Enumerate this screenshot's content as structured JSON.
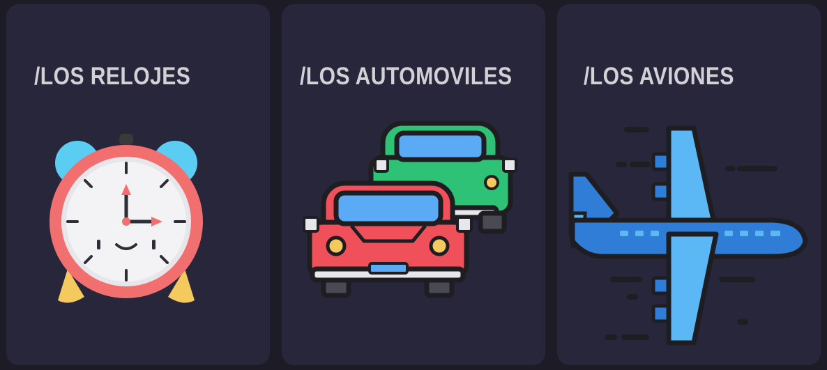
{
  "cards": [
    {
      "title": "/LOS RELOJES",
      "icon": "alarm-clock-icon"
    },
    {
      "title": "/LOS AUTOMOVILES",
      "icon": "cars-icon"
    },
    {
      "title": "/LOS AVIONES",
      "icon": "airplane-icon"
    }
  ],
  "colors": {
    "page_background": "#1c1b26",
    "card_background": "#28263a",
    "title_text": "#d2d2d6",
    "clock_red": "#f26f6f",
    "clock_blue": "#5ccdf2",
    "clock_yellow": "#f4c95d",
    "car_red": "#f0505a",
    "car_green": "#2ec276",
    "car_window": "#5aaaf5",
    "plane_blue": "#2f7dd6",
    "plane_light_blue": "#5cb8f5"
  }
}
